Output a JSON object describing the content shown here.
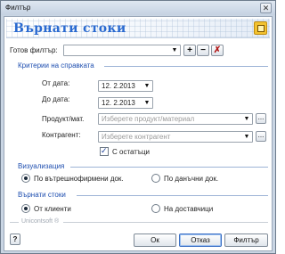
{
  "window": {
    "title": "Филтър",
    "close_glyph": "✕"
  },
  "banner": {
    "title": "Върнати стоки",
    "logo_icon": "app-logo-icon"
  },
  "filter": {
    "label": "Готов филтър:",
    "value": "",
    "add_glyph": "+",
    "remove_glyph": "−",
    "clear_glyph": "✗"
  },
  "criteria": {
    "heading": "Критерии на справката",
    "from_label": "От дата:",
    "from_value": "12.  2.2013",
    "to_label": "До дата:",
    "to_value": "12.  2.2013",
    "product_label": "Продукт/мат.",
    "product_placeholder": "Изберете продукт/материал",
    "contractor_label": "Контрагент:",
    "contractor_placeholder": "Изберете контрагент",
    "with_stock_label": "С остатъци",
    "with_stock_checked": true,
    "browse_glyph": "..."
  },
  "visualization": {
    "heading": "Визуализация",
    "options": [
      {
        "label": "По вътрешнофирмени док.",
        "selected": true
      },
      {
        "label": "По данъчни док.",
        "selected": false
      }
    ]
  },
  "returned": {
    "heading": "Върнати стоки",
    "options": [
      {
        "label": "От клиенти",
        "selected": true
      },
      {
        "label": "На доставчици",
        "selected": false
      }
    ]
  },
  "footer": {
    "brand": "Unicontsoft ®",
    "help_glyph": "?",
    "ok_label": "Ок",
    "cancel_label": "Отказ",
    "filter_label": "Филтър"
  },
  "colors": {
    "accent": "#2a6ad0",
    "section": "#1f4fb0",
    "frame": "#c9d5e3"
  }
}
